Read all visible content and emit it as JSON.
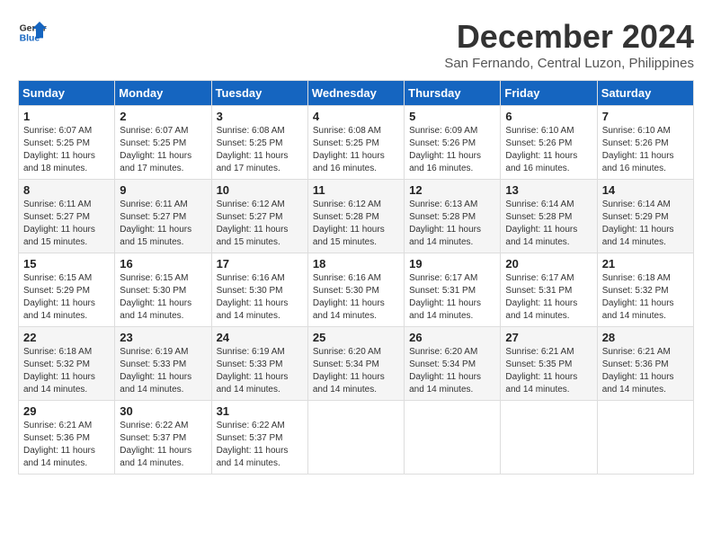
{
  "logo": {
    "line1": "General",
    "line2": "Blue"
  },
  "title": "December 2024",
  "location": "San Fernando, Central Luzon, Philippines",
  "weekdays": [
    "Sunday",
    "Monday",
    "Tuesday",
    "Wednesday",
    "Thursday",
    "Friday",
    "Saturday"
  ],
  "weeks": [
    [
      {
        "day": "1",
        "sunrise": "6:07 AM",
        "sunset": "5:25 PM",
        "daylight": "11 hours and 18 minutes."
      },
      {
        "day": "2",
        "sunrise": "6:07 AM",
        "sunset": "5:25 PM",
        "daylight": "11 hours and 17 minutes."
      },
      {
        "day": "3",
        "sunrise": "6:08 AM",
        "sunset": "5:25 PM",
        "daylight": "11 hours and 17 minutes."
      },
      {
        "day": "4",
        "sunrise": "6:08 AM",
        "sunset": "5:25 PM",
        "daylight": "11 hours and 16 minutes."
      },
      {
        "day": "5",
        "sunrise": "6:09 AM",
        "sunset": "5:26 PM",
        "daylight": "11 hours and 16 minutes."
      },
      {
        "day": "6",
        "sunrise": "6:10 AM",
        "sunset": "5:26 PM",
        "daylight": "11 hours and 16 minutes."
      },
      {
        "day": "7",
        "sunrise": "6:10 AM",
        "sunset": "5:26 PM",
        "daylight": "11 hours and 16 minutes."
      }
    ],
    [
      {
        "day": "8",
        "sunrise": "6:11 AM",
        "sunset": "5:27 PM",
        "daylight": "11 hours and 15 minutes."
      },
      {
        "day": "9",
        "sunrise": "6:11 AM",
        "sunset": "5:27 PM",
        "daylight": "11 hours and 15 minutes."
      },
      {
        "day": "10",
        "sunrise": "6:12 AM",
        "sunset": "5:27 PM",
        "daylight": "11 hours and 15 minutes."
      },
      {
        "day": "11",
        "sunrise": "6:12 AM",
        "sunset": "5:28 PM",
        "daylight": "11 hours and 15 minutes."
      },
      {
        "day": "12",
        "sunrise": "6:13 AM",
        "sunset": "5:28 PM",
        "daylight": "11 hours and 14 minutes."
      },
      {
        "day": "13",
        "sunrise": "6:14 AM",
        "sunset": "5:28 PM",
        "daylight": "11 hours and 14 minutes."
      },
      {
        "day": "14",
        "sunrise": "6:14 AM",
        "sunset": "5:29 PM",
        "daylight": "11 hours and 14 minutes."
      }
    ],
    [
      {
        "day": "15",
        "sunrise": "6:15 AM",
        "sunset": "5:29 PM",
        "daylight": "11 hours and 14 minutes."
      },
      {
        "day": "16",
        "sunrise": "6:15 AM",
        "sunset": "5:30 PM",
        "daylight": "11 hours and 14 minutes."
      },
      {
        "day": "17",
        "sunrise": "6:16 AM",
        "sunset": "5:30 PM",
        "daylight": "11 hours and 14 minutes."
      },
      {
        "day": "18",
        "sunrise": "6:16 AM",
        "sunset": "5:30 PM",
        "daylight": "11 hours and 14 minutes."
      },
      {
        "day": "19",
        "sunrise": "6:17 AM",
        "sunset": "5:31 PM",
        "daylight": "11 hours and 14 minutes."
      },
      {
        "day": "20",
        "sunrise": "6:17 AM",
        "sunset": "5:31 PM",
        "daylight": "11 hours and 14 minutes."
      },
      {
        "day": "21",
        "sunrise": "6:18 AM",
        "sunset": "5:32 PM",
        "daylight": "11 hours and 14 minutes."
      }
    ],
    [
      {
        "day": "22",
        "sunrise": "6:18 AM",
        "sunset": "5:32 PM",
        "daylight": "11 hours and 14 minutes."
      },
      {
        "day": "23",
        "sunrise": "6:19 AM",
        "sunset": "5:33 PM",
        "daylight": "11 hours and 14 minutes."
      },
      {
        "day": "24",
        "sunrise": "6:19 AM",
        "sunset": "5:33 PM",
        "daylight": "11 hours and 14 minutes."
      },
      {
        "day": "25",
        "sunrise": "6:20 AM",
        "sunset": "5:34 PM",
        "daylight": "11 hours and 14 minutes."
      },
      {
        "day": "26",
        "sunrise": "6:20 AM",
        "sunset": "5:34 PM",
        "daylight": "11 hours and 14 minutes."
      },
      {
        "day": "27",
        "sunrise": "6:21 AM",
        "sunset": "5:35 PM",
        "daylight": "11 hours and 14 minutes."
      },
      {
        "day": "28",
        "sunrise": "6:21 AM",
        "sunset": "5:36 PM",
        "daylight": "11 hours and 14 minutes."
      }
    ],
    [
      {
        "day": "29",
        "sunrise": "6:21 AM",
        "sunset": "5:36 PM",
        "daylight": "11 hours and 14 minutes."
      },
      {
        "day": "30",
        "sunrise": "6:22 AM",
        "sunset": "5:37 PM",
        "daylight": "11 hours and 14 minutes."
      },
      {
        "day": "31",
        "sunrise": "6:22 AM",
        "sunset": "5:37 PM",
        "daylight": "11 hours and 14 minutes."
      },
      null,
      null,
      null,
      null
    ]
  ],
  "labels": {
    "sunrise": "Sunrise:",
    "sunset": "Sunset:",
    "daylight": "Daylight:"
  }
}
